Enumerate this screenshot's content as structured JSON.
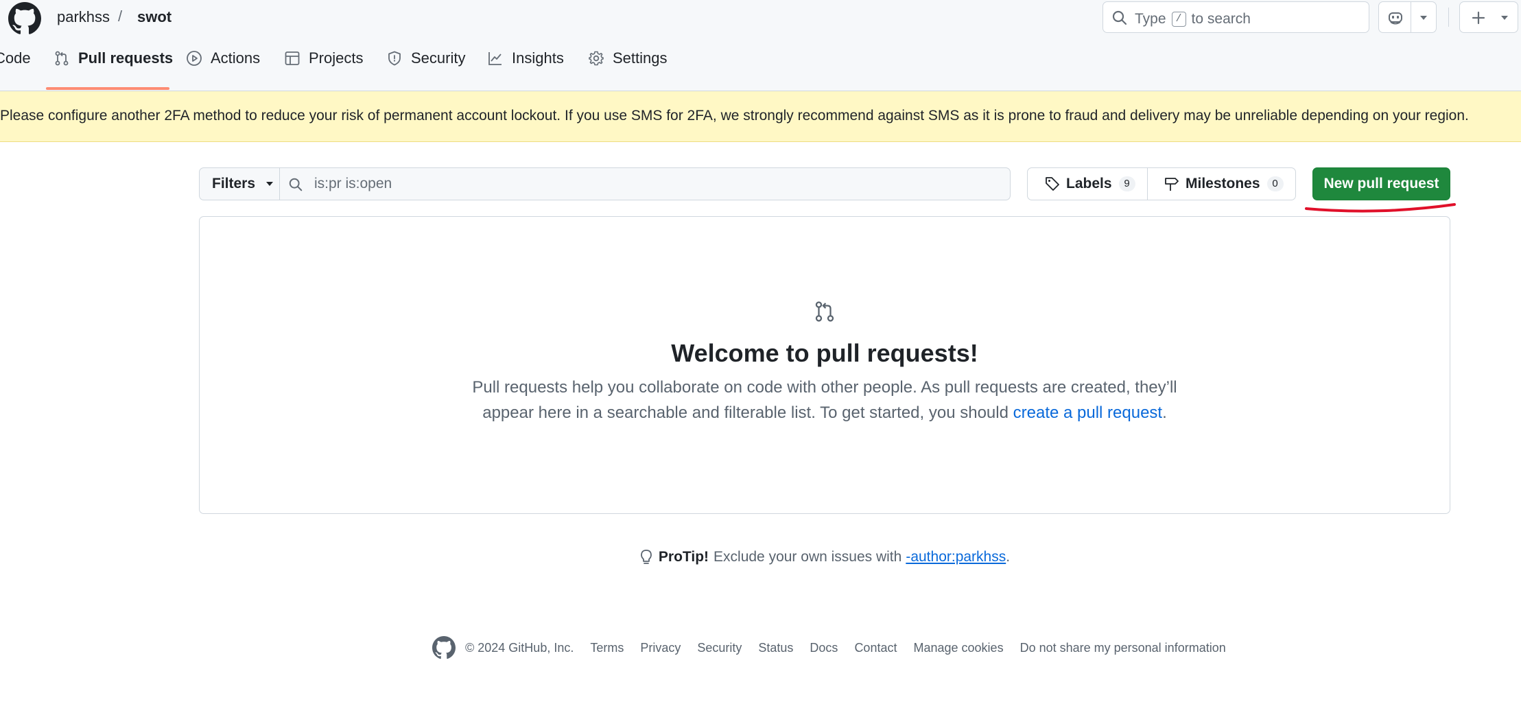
{
  "header": {
    "owner": "parkhss",
    "separator": "/",
    "repo": "swot",
    "search_prefix": "Type",
    "search_key": "/",
    "search_suffix": "to search"
  },
  "tabs": [
    {
      "label": "Code",
      "icon": "code-icon"
    },
    {
      "label": "Pull requests",
      "icon": "git-pull-request-icon",
      "active": true
    },
    {
      "label": "Actions",
      "icon": "play-icon"
    },
    {
      "label": "Projects",
      "icon": "table-icon"
    },
    {
      "label": "Security",
      "icon": "shield-icon"
    },
    {
      "label": "Insights",
      "icon": "graph-icon"
    },
    {
      "label": "Settings",
      "icon": "gear-icon"
    }
  ],
  "banner": {
    "text": "Please configure another 2FA method to reduce your risk of permanent account lockout. If you use SMS for 2FA, we strongly recommend against SMS as it is prone to fraud and delivery may be unreliable depending on your region."
  },
  "toolbar": {
    "filters_label": "Filters",
    "filter_value": "is:pr is:open",
    "labels_label": "Labels",
    "labels_count": "9",
    "milestones_label": "Milestones",
    "milestones_count": "0",
    "new_pr_label": "New pull request"
  },
  "blankslate": {
    "title": "Welcome to pull requests!",
    "desc_line1": "Pull requests help you collaborate on code with other people. As pull requests are created, they’ll",
    "desc_line2": "appear here in a searchable and filterable list. To get started, you should",
    "link": "create a pull request",
    "link_suffix": "."
  },
  "protip": {
    "label": "ProTip!",
    "text": "Exclude your own issues with",
    "link": "-author:parkhss",
    "suffix": "."
  },
  "footer": {
    "copyright": "© 2024 GitHub, Inc.",
    "links": [
      "Terms",
      "Privacy",
      "Security",
      "Status",
      "Docs",
      "Contact",
      "Manage cookies",
      "Do not share my personal information"
    ]
  },
  "colors": {
    "primary_button": "#1f883d",
    "link": "#0969da",
    "active_tab_underline": "#fd8c73",
    "banner_bg": "#fff8c5",
    "annotation": "#e0102a"
  }
}
